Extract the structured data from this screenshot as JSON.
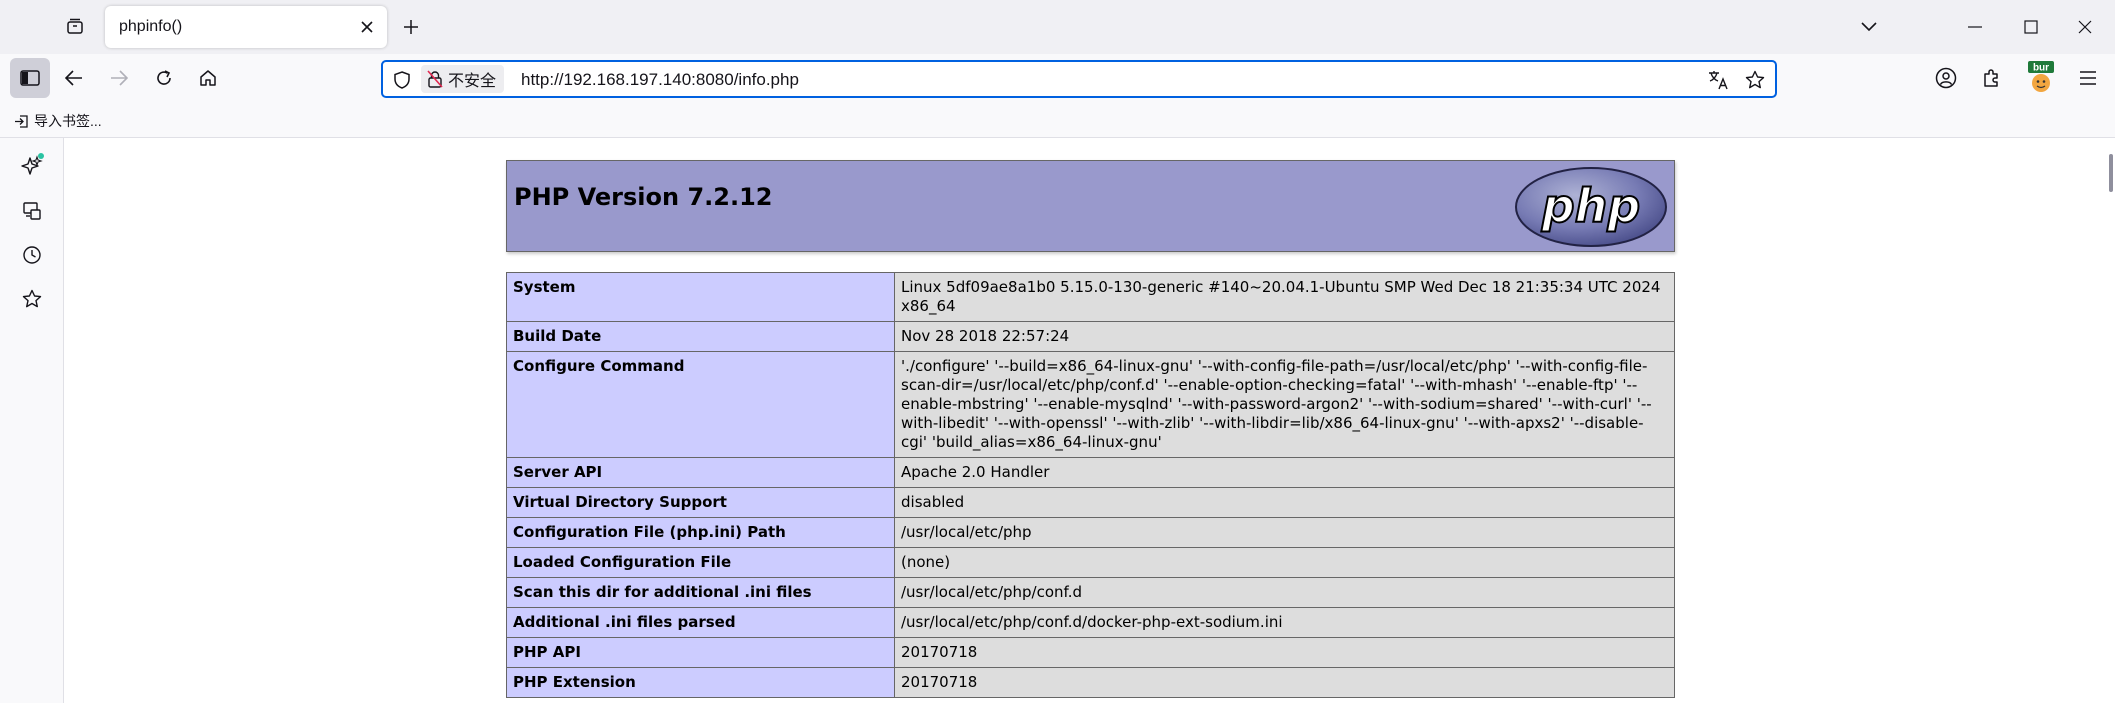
{
  "tab": {
    "title": "phpinfo()"
  },
  "navbar": {
    "insecure_label": "不安全",
    "url": "http://192.168.197.140:8080/info.php"
  },
  "extensions": {
    "burp_label": "bur"
  },
  "bookmarks_bar": {
    "import_label": "导入书签..."
  },
  "php": {
    "version_title": "PHP Version 7.2.12",
    "logo_text": "php"
  },
  "info_rows": [
    {
      "key": "System",
      "value": "Linux 5df09ae8a1b0 5.15.0-130-generic #140~20.04.1-Ubuntu SMP Wed Dec 18 21:35:34 UTC 2024 x86_64"
    },
    {
      "key": "Build Date",
      "value": "Nov 28 2018 22:57:24"
    },
    {
      "key": "Configure Command",
      "value": "'./configure' '--build=x86_64-linux-gnu' '--with-config-file-path=/usr/local/etc/php' '--with-config-file-scan-dir=/usr/local/etc/php/conf.d' '--enable-option-checking=fatal' '--with-mhash' '--enable-ftp' '--enable-mbstring' '--enable-mysqlnd' '--with-password-argon2' '--with-sodium=shared' '--with-curl' '--with-libedit' '--with-openssl' '--with-zlib' '--with-libdir=lib/x86_64-linux-gnu' '--with-apxs2' '--disable-cgi' 'build_alias=x86_64-linux-gnu'"
    },
    {
      "key": "Server API",
      "value": "Apache 2.0 Handler"
    },
    {
      "key": "Virtual Directory Support",
      "value": "disabled"
    },
    {
      "key": "Configuration File (php.ini) Path",
      "value": "/usr/local/etc/php"
    },
    {
      "key": "Loaded Configuration File",
      "value": "(none)"
    },
    {
      "key": "Scan this dir for additional .ini files",
      "value": "/usr/local/etc/php/conf.d"
    },
    {
      "key": "Additional .ini files parsed",
      "value": "/usr/local/etc/php/conf.d/docker-php-ext-sodium.ini"
    },
    {
      "key": "PHP API",
      "value": "20170718"
    },
    {
      "key": "PHP Extension",
      "value": "20170718"
    }
  ],
  "colors": {
    "header_bg": "#9999cc",
    "key_cell_bg": "#ccccff",
    "value_cell_bg": "#dddddd",
    "urlbar_focus": "#0061e0"
  }
}
